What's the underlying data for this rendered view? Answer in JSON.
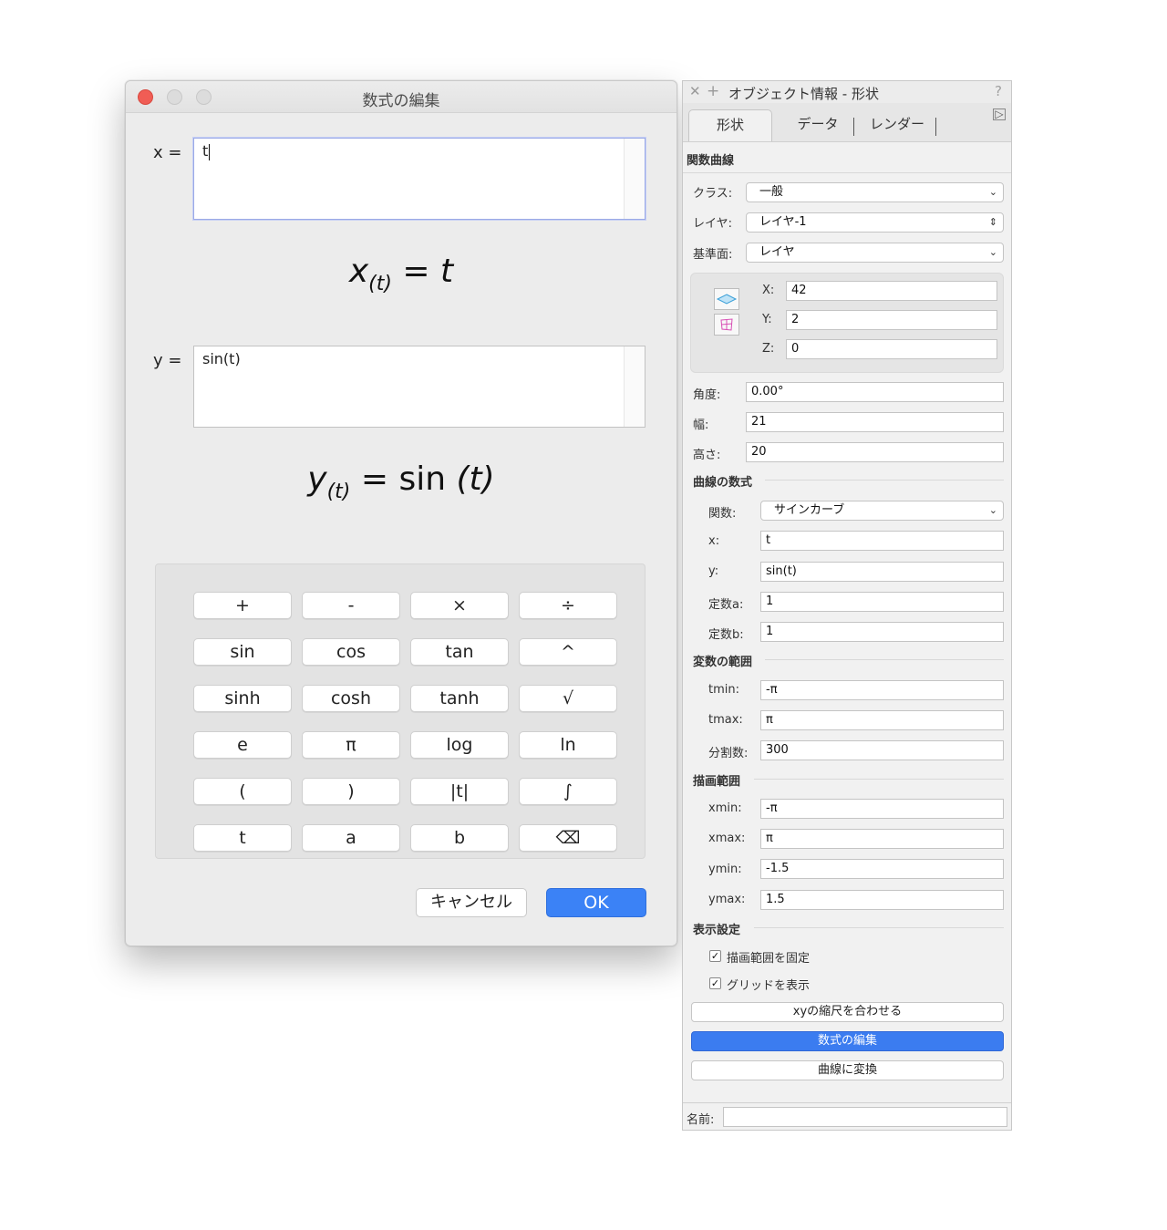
{
  "dialog": {
    "title": "数式の編集",
    "x_label": "x =",
    "x_value": "t",
    "y_label": "y =",
    "y_value": "sin(t)",
    "x_formula": {
      "var": "x",
      "sub": "(t)",
      "eq": "=",
      "rhs": "t"
    },
    "y_formula": {
      "var": "y",
      "sub": "(t)",
      "eq": "=",
      "rhs_fn": "sin",
      "rhs_arg": "(t)"
    },
    "keys": [
      [
        "+",
        "-",
        "×",
        "÷"
      ],
      [
        "sin",
        "cos",
        "tan",
        "^"
      ],
      [
        "sinh",
        "cosh",
        "tanh",
        "√"
      ],
      [
        "e",
        "π",
        "log",
        "ln"
      ],
      [
        "(",
        ")",
        "|t|",
        "∫"
      ],
      [
        "t",
        "a",
        "b",
        "⌫"
      ]
    ],
    "cancel_label": "キャンセル",
    "ok_label": "OK"
  },
  "palette": {
    "close_glyph": "✕",
    "plus_glyph": "+",
    "title": "オブジェクト情報 - 形状",
    "help_glyph": "?",
    "tabs": [
      "形状",
      "データ",
      "レンダー"
    ],
    "more_glyph": "▷",
    "object_type": "関数曲線",
    "class_label": "クラス:",
    "class_value": "一般",
    "layer_label": "レイヤ:",
    "layer_value": "レイヤ-1",
    "plane_label": "基準面:",
    "plane_value": "レイヤ",
    "x_label": "X:",
    "x_value": "42",
    "y_label": "Y:",
    "y_value": "2",
    "z_label": "Z:",
    "z_value": "0",
    "angle_label": "角度:",
    "angle_value": "0.00°",
    "width_label": "幅:",
    "width_value": "21",
    "height_label": "高さ:",
    "height_value": "20",
    "curve_section": "曲線の数式",
    "func_label": "関数:",
    "func_value": "サインカーブ",
    "cx_label": "x:",
    "cx_value": "t",
    "cy_label": "y:",
    "cy_value": "sin(t)",
    "ca_label": "定数a:",
    "ca_value": "1",
    "cb_label": "定数b:",
    "cb_value": "1",
    "range_section": "変数の範囲",
    "tmin_label": "tmin:",
    "tmin_value": "-π",
    "tmax_label": "tmax:",
    "tmax_value": "π",
    "div_label": "分割数:",
    "div_value": "300",
    "draw_section": "描画範囲",
    "xmin_label": "xmin:",
    "xmin_value": "-π",
    "xmax_label": "xmax:",
    "xmax_value": "π",
    "ymin_label": "ymin:",
    "ymin_value": "-1.5",
    "ymax_label": "ymax:",
    "ymax_value": "1.5",
    "display_section": "表示設定",
    "fix_range_label": "描画範囲を固定",
    "fix_range_checked": true,
    "show_grid_label": "グリッドを表示",
    "show_grid_checked": true,
    "check_glyph": "✓",
    "match_scale_label": "xyの縮尺を合わせる",
    "edit_formula_label": "数式の編集",
    "convert_label": "曲線に変換",
    "name_label": "名前:",
    "name_value": ""
  },
  "colors": {
    "accent": "#3b82f6",
    "close_red": "#f05d55"
  }
}
